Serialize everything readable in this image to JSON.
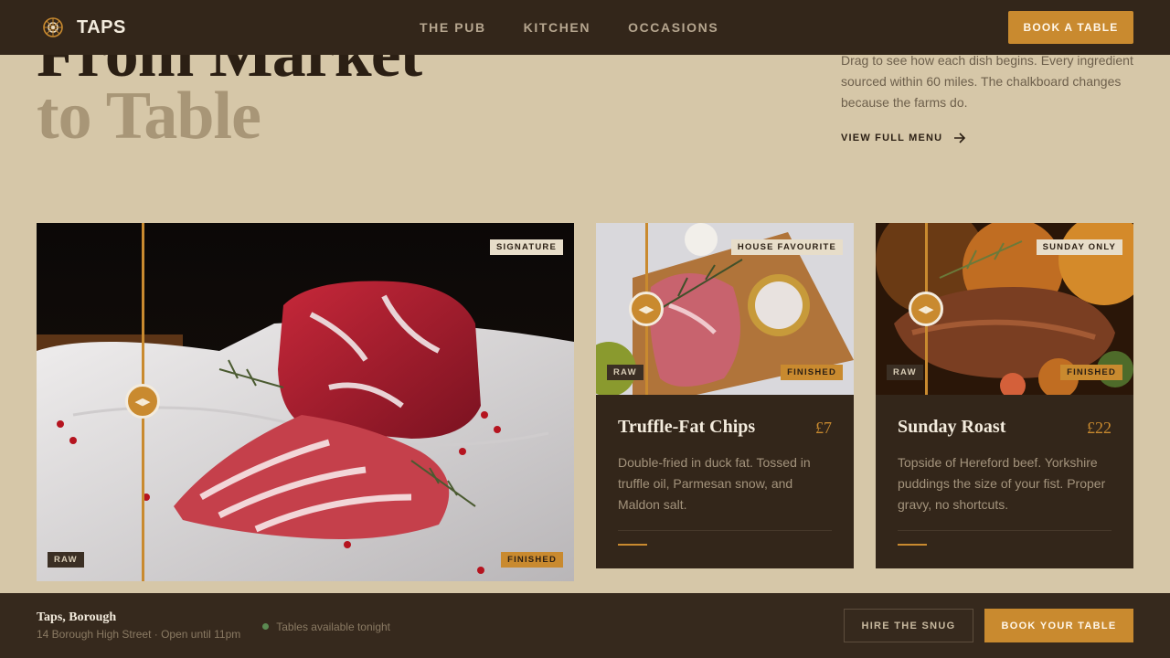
{
  "nav": {
    "brand": "TAPS",
    "links": [
      "THE PUB",
      "KITCHEN",
      "OCCASIONS"
    ],
    "cta": "BOOK A TABLE"
  },
  "hero": {
    "title_line1": "From Market",
    "title_line2": "to Table",
    "description": "Drag to see how each dish begins. Every ingredient sourced within 60 miles. The chalkboard changes because the farms do.",
    "menu_link": "VIEW FULL MENU"
  },
  "cards": {
    "signature": {
      "badge": "SIGNATURE",
      "raw_label": "RAW",
      "finished_label": "FINISHED"
    },
    "chips": {
      "badge": "HOUSE FAVOURITE",
      "raw_label": "RAW",
      "finished_label": "FINISHED",
      "title": "Truffle-Fat Chips",
      "price": "£7",
      "description": "Double-fried in duck fat. Tossed in truffle oil, Parmesan snow, and Maldon salt."
    },
    "roast": {
      "badge": "SUNDAY ONLY",
      "raw_label": "RAW",
      "finished_label": "FINISHED",
      "title": "Sunday Roast",
      "price": "£22",
      "description": "Topside of Hereford beef. Yorkshire puddings the size of your fist. Proper gravy, no shortcuts."
    }
  },
  "footer": {
    "venue": "Taps, Borough",
    "address": "14 Borough High Street · Open until 11pm",
    "status": "Tables available tonight",
    "secondary_button": "HIRE THE SNUG",
    "primary_button": "BOOK YOUR TABLE"
  },
  "colors": {
    "background": "#d6c7a8",
    "dark": "#33261a",
    "accent": "#c98a2f",
    "status_green": "#5b8a52"
  },
  "icons": {
    "logo": "knot-emblem-icon",
    "menu_arrow": "arrow-right-icon",
    "slider_handle": "left-right-arrows-icon"
  }
}
